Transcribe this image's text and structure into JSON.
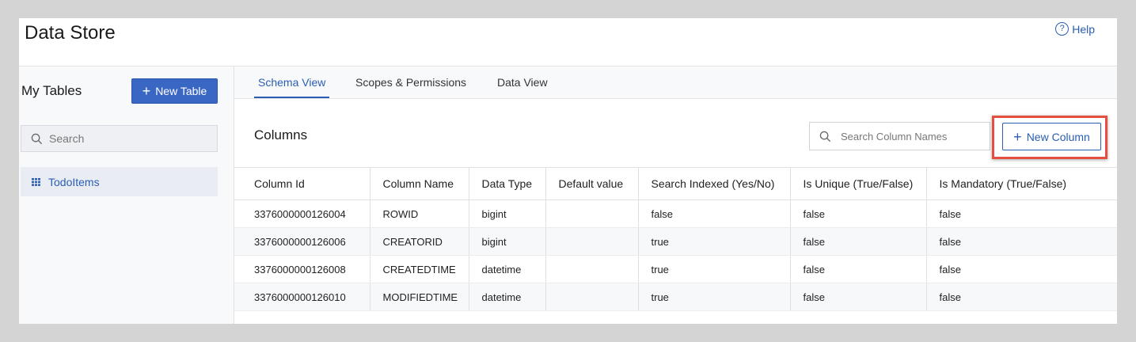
{
  "app": {
    "title": "Data Store",
    "help_label": "Help"
  },
  "sidebar": {
    "title": "My Tables",
    "new_table_label": "New Table",
    "search_placeholder": "Search",
    "tables": [
      {
        "label": "TodoItems"
      }
    ]
  },
  "tabs": [
    {
      "label": "Schema View",
      "active": true
    },
    {
      "label": "Scopes & Permissions",
      "active": false
    },
    {
      "label": "Data View",
      "active": false
    }
  ],
  "columns_panel": {
    "title": "Columns",
    "search_placeholder": "Search Column Names",
    "new_column_label": "New Column"
  },
  "table": {
    "headers": [
      "Column Id",
      "Column Name",
      "Data Type",
      "Default value",
      "Search Indexed (Yes/No)",
      "Is Unique (True/False)",
      "Is Mandatory (True/False)"
    ],
    "rows": [
      [
        "3376000000126004",
        "ROWID",
        "bigint",
        "",
        "false",
        "false",
        "false"
      ],
      [
        "3376000000126006",
        "CREATORID",
        "bigint",
        "",
        "true",
        "false",
        "false"
      ],
      [
        "3376000000126008",
        "CREATEDTIME",
        "datetime",
        "",
        "true",
        "false",
        "false"
      ],
      [
        "3376000000126010",
        "MODIFIEDTIME",
        "datetime",
        "",
        "true",
        "false",
        "false"
      ]
    ]
  },
  "colors": {
    "accent": "#2b5db3",
    "primary_button": "#3b67c4",
    "highlight": "#e3503f"
  }
}
